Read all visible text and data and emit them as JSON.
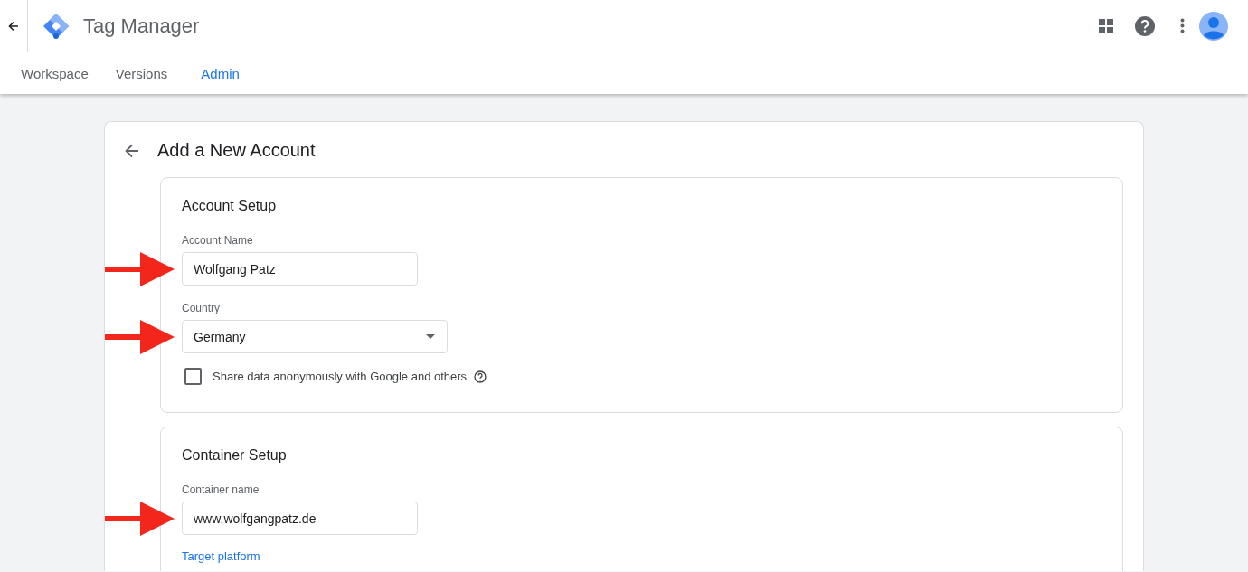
{
  "app": {
    "title": "Tag Manager"
  },
  "tabs": [
    {
      "label": "Workspace",
      "selected": false
    },
    {
      "label": "Versions",
      "selected": false
    },
    {
      "label": "Admin",
      "selected": true
    }
  ],
  "page": {
    "title": "Add a New Account"
  },
  "sections": [
    {
      "title": "Account Setup",
      "items": [
        {
          "kind": "text",
          "label": "Account Name",
          "value": "Wolfgang Patz",
          "arrow": true
        },
        {
          "kind": "select",
          "label": "Country",
          "value": "Germany",
          "arrow": true
        },
        {
          "kind": "checkbox",
          "label": "Share data anonymously with Google and others",
          "checked": false
        }
      ]
    },
    {
      "title": "Container Setup",
      "items": [
        {
          "kind": "text",
          "label": "Container name",
          "value": "www.wolfgangpatz.de",
          "arrow": true
        },
        {
          "kind": "link",
          "label": "Target platform"
        }
      ]
    }
  ]
}
